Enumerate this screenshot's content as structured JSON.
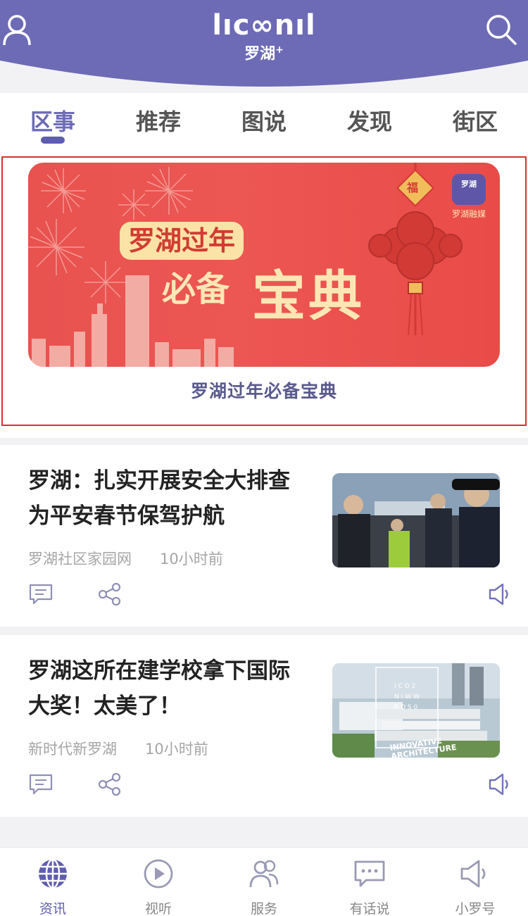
{
  "header": {
    "logo_wordmark": "lıc∞nıl",
    "logo_sub": "罗湖",
    "logo_sup": "+",
    "accent": "#6d6bb5"
  },
  "tabs": [
    {
      "label": "区事",
      "active": true
    },
    {
      "label": "推荐",
      "active": false
    },
    {
      "label": "图说",
      "active": false
    },
    {
      "label": "发现",
      "active": false
    },
    {
      "label": "街区",
      "active": false
    }
  ],
  "banner": {
    "pill": "罗湖过年",
    "line1": "必备",
    "line2": "宝典",
    "badge_text": "罗湖",
    "badge_label": "罗湖融媒",
    "fu": "福",
    "caption": "罗湖过年必备宝典"
  },
  "articles": [
    {
      "title": "罗湖：扎实开展安全大排查 为平安春节保驾护航",
      "source": "罗湖社区家园网",
      "time": "10小时前",
      "thumb": "police-officers-photo"
    },
    {
      "title": "罗湖这所在建学校拿下国际大奖！太美了！",
      "source": "新时代新罗湖",
      "time": "10小时前",
      "thumb": "architecture-rendering",
      "thumb_text": "INNOVATIVE ARCHITECTURE"
    }
  ],
  "bottom_nav": [
    {
      "label": "资讯",
      "icon": "globe-icon",
      "active": true
    },
    {
      "label": "视听",
      "icon": "play-icon",
      "active": false
    },
    {
      "label": "服务",
      "icon": "people-icon",
      "active": false
    },
    {
      "label": "有话说",
      "icon": "chat-icon",
      "active": false
    },
    {
      "label": "小罗号",
      "icon": "speaker-icon",
      "active": false
    }
  ]
}
